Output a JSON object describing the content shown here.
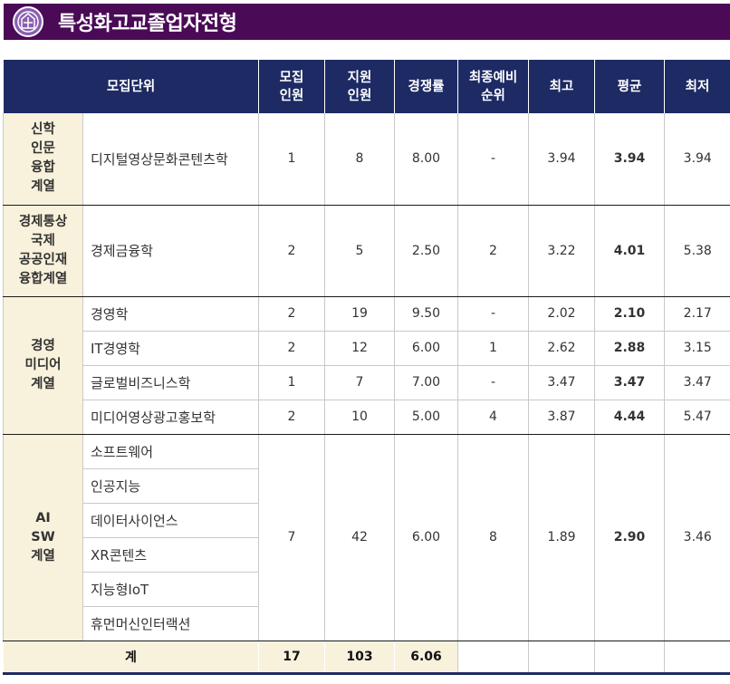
{
  "title": "특성화고교졸업자전형",
  "colors": {
    "title_bar": "#4a0a56",
    "header": "#1d2a63",
    "group_bg": "#f8f2dc"
  },
  "logo_icon": "university-seal-icon",
  "headers": {
    "unit": "모집단위",
    "quota_1": "모집",
    "quota_2": "인원",
    "applicants_1": "지원",
    "applicants_2": "인원",
    "ratio": "경쟁률",
    "waitlist_1": "최종예비",
    "waitlist_2": "순위",
    "max": "최고",
    "avg": "평균",
    "min": "최저"
  },
  "groups": [
    {
      "lines": [
        "신학",
        "인문",
        "융합",
        "계열"
      ],
      "rows": [
        {
          "dept": "디지털영상문화콘텐츠학",
          "quota": "1",
          "applicants": "8",
          "ratio": "8.00",
          "waitlist": "-",
          "max": "3.94",
          "avg": "3.94",
          "min": "3.94"
        }
      ]
    },
    {
      "lines": [
        "경제통상",
        "국제",
        "공공인재",
        "융합계열"
      ],
      "rows": [
        {
          "dept": "경제금융학",
          "quota": "2",
          "applicants": "5",
          "ratio": "2.50",
          "waitlist": "2",
          "max": "3.22",
          "avg": "4.01",
          "min": "5.38"
        }
      ]
    },
    {
      "lines": [
        "경영",
        "미디어",
        "계열"
      ],
      "rows": [
        {
          "dept": "경영학",
          "quota": "2",
          "applicants": "19",
          "ratio": "9.50",
          "waitlist": "-",
          "max": "2.02",
          "avg": "2.10",
          "min": "2.17"
        },
        {
          "dept": "IT경영학",
          "quota": "2",
          "applicants": "12",
          "ratio": "6.00",
          "waitlist": "1",
          "max": "2.62",
          "avg": "2.88",
          "min": "3.15"
        },
        {
          "dept": "글로벌비즈니스학",
          "quota": "1",
          "applicants": "7",
          "ratio": "7.00",
          "waitlist": "-",
          "max": "3.47",
          "avg": "3.47",
          "min": "3.47"
        },
        {
          "dept": "미디어영상광고홍보학",
          "quota": "2",
          "applicants": "10",
          "ratio": "5.00",
          "waitlist": "4",
          "max": "3.87",
          "avg": "4.44",
          "min": "5.47"
        }
      ]
    },
    {
      "lines": [
        "AI",
        "SW",
        "계열"
      ],
      "depts": [
        "소프트웨어",
        "인공지능",
        "데이터사이언스",
        "XR콘텐츠",
        "지능형IoT",
        "휴먼머신인터랙션"
      ],
      "merged": {
        "quota": "7",
        "applicants": "42",
        "ratio": "6.00",
        "waitlist": "8",
        "max": "1.89",
        "avg": "2.90",
        "min": "3.46"
      }
    }
  ],
  "total": {
    "label": "계",
    "quota": "17",
    "applicants": "103",
    "ratio": "6.06"
  }
}
